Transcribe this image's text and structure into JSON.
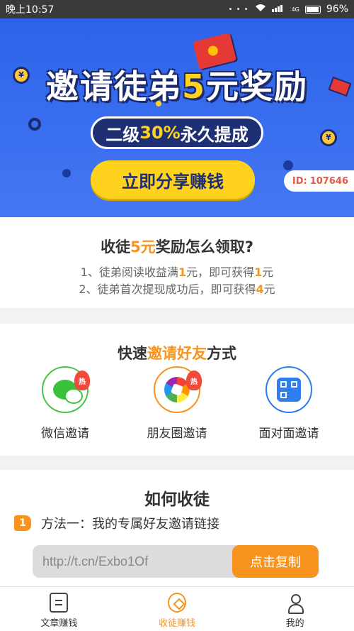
{
  "status_bar": {
    "time": "晚上10:57",
    "battery": "96%",
    "signal_text": "4G"
  },
  "banner": {
    "title_before": "邀请徒弟",
    "title_highlight": "5",
    "title_after": "元奖励",
    "sub_before": "二级",
    "sub_highlight": "30%",
    "sub_after": "永久提成",
    "share_button": "立即分享赚钱",
    "id_label": "ID:",
    "id_value": "107646",
    "colors": {
      "background": "#2d63e8",
      "accent": "#ffd21e",
      "dark": "#1f2f74"
    }
  },
  "reward": {
    "title_before": "收徒",
    "title_highlight": "5元",
    "title_after": "奖励怎么领取?",
    "line1_before": "1、徒弟阅读收益满",
    "line1_num": "1",
    "line1_mid": "元，即可获得",
    "line1_num2": "1",
    "line1_after": "元",
    "line2_before": "2、徒弟首次提现成功后，即可获得",
    "line2_num": "4",
    "line2_after": "元"
  },
  "quick_invite": {
    "title_before": "快速",
    "title_highlight": "邀请好友",
    "title_after": "方式",
    "hot_badge": "热",
    "items": [
      {
        "label": "微信邀请",
        "icon": "wechat-icon",
        "color": "#4cc14c"
      },
      {
        "label": "朋友圈邀请",
        "icon": "moments-icon",
        "color": "#f7931e"
      },
      {
        "label": "面对面邀请",
        "icon": "qrcode-icon",
        "color": "#2f7ef0"
      }
    ]
  },
  "how_to": {
    "title": "如何收徒",
    "method_number": "1",
    "method_label": "方法一：我的专属好友邀请链接",
    "link_value": "http://t.cn/Exbo1Of",
    "copy_button": "点击复制"
  },
  "tab_bar": {
    "tabs": [
      {
        "label": "文章赚钱",
        "icon": "article-icon",
        "active": false
      },
      {
        "label": "收徒赚钱",
        "icon": "invite-icon",
        "active": true
      },
      {
        "label": "我的",
        "icon": "user-icon",
        "active": false
      }
    ],
    "active_color": "#f7931e"
  }
}
